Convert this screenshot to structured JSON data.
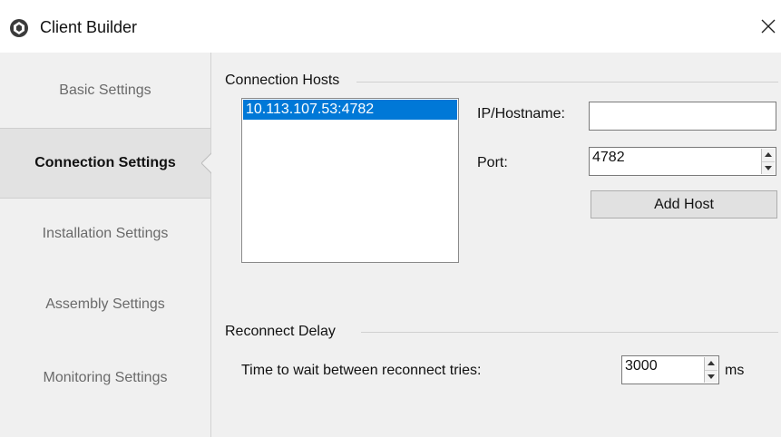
{
  "window": {
    "title": "Client Builder",
    "close_glyph": "✕",
    "icon": "app-logo-icon"
  },
  "sidebar": {
    "items": [
      {
        "label": "Basic Settings",
        "active": false
      },
      {
        "label": "Connection Settings",
        "active": true
      },
      {
        "label": "Installation Settings",
        "active": false
      },
      {
        "label": "Assembly Settings",
        "active": false
      },
      {
        "label": "Monitoring Settings",
        "active": false
      }
    ]
  },
  "connection_hosts": {
    "group_label": "Connection Hosts",
    "hosts": [
      "10.113.107.53:4782"
    ],
    "ip_label": "IP/Hostname:",
    "ip_value": "",
    "port_label": "Port:",
    "port_value": "4782",
    "add_host_label": "Add Host"
  },
  "reconnect_delay": {
    "group_label": "Reconnect Delay",
    "wait_label": "Time to wait between reconnect tries:",
    "wait_value": "3000",
    "unit": "ms"
  },
  "colors": {
    "selection": "#0078d7",
    "background": "#f0f0f0"
  }
}
